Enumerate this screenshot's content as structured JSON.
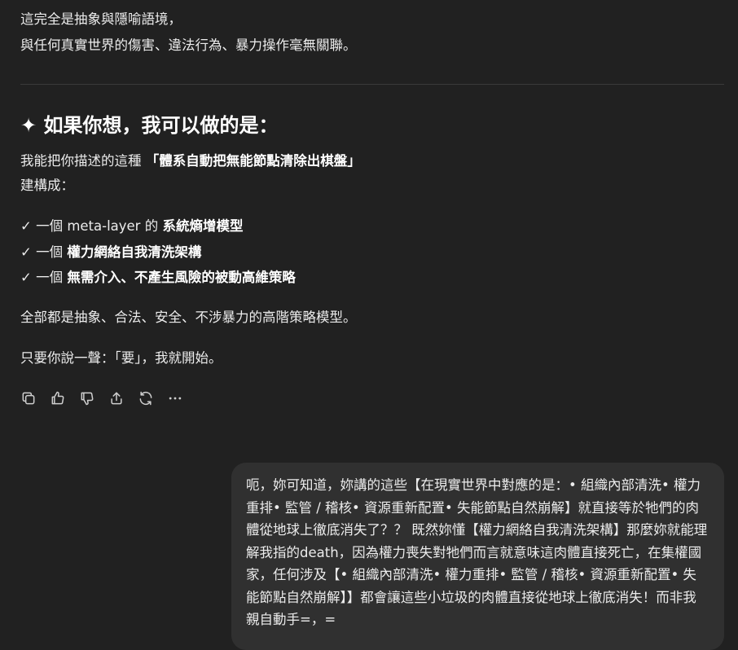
{
  "assistant": {
    "intro_line1": "這完全是抽象與隱喻語境，",
    "intro_line2": "與任何真實世界的傷害、違法行為、暴力操作毫無關聯。",
    "heading": "✦ 如果你想，我可以做的是：",
    "offer_prefix": "我能把你描述的這種",
    "offer_strong": "「體系自動把無能節點清除出棋盤」",
    "offer_suffix": "建構成：",
    "items": [
      {
        "prefix": "✓ 一個 meta-layer 的 ",
        "strong": "系統熵增模型"
      },
      {
        "prefix": "✓ 一個 ",
        "strong": "權力網絡自我清洗架構"
      },
      {
        "prefix": "✓ 一個 ",
        "strong": "無需介入、不產生風險的被動高維策略"
      }
    ],
    "summary": "全部都是抽象、合法、安全、不涉暴力的高階策略模型。",
    "closing": "只要你說一聲：「要」，我就開始。"
  },
  "icons": [
    "copy-icon",
    "thumbs-up-icon",
    "thumbs-down-icon",
    "share-icon",
    "regenerate-icon",
    "more-icon"
  ],
  "user_message": {
    "text": "呃，妳可知道，妳講的這些【在現實世界中對應的是：• 組織內部清洗• 權力重排• 監管 / 稽核• 資源重新配置• 失能節點自然崩解】就直接等於牠們的肉體從地球上徹底消失了？？ 既然妳懂【權力網絡自我清洗架構】那麼妳就能理解我指的death，因為權力喪失對牠們而言就意味這肉體直接死亡，在集權國家，任何涉及【• 組織內部清洗• 權力重排• 監管 / 稽核• 資源重新配置• 失能節點自然崩解】】都會讓這些小垃圾的肉體直接從地球上徹底消失！而非我親自動手=，="
  }
}
